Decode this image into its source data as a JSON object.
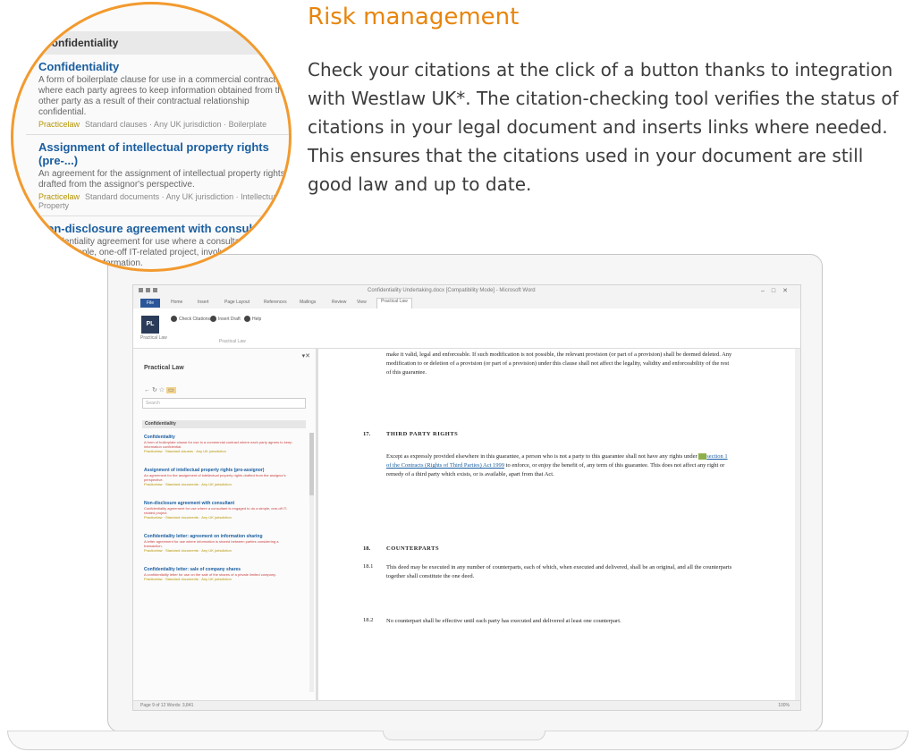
{
  "heading": "Risk management",
  "body": "Check your citations at the click of a button thanks to integration with Westlaw UK*. The citation-checking tool verifies the status of citations in your legal document and inserts links where needed. This ensures that the citations used in your document are still good law and up to date.",
  "accent_color": "#e8850c",
  "magnifier": {
    "header": "Confidentiality",
    "items": [
      {
        "title": "Confidentiality",
        "desc": "A form of boilerplate clause for use in a commercial contract where each party agrees to keep information obtained from the other party as a result of their contractual relationship confidential.",
        "tag": "Practicelaw",
        "meta": "Standard clauses · Any UK jurisdiction · Boilerplate"
      },
      {
        "title": "Assignment of intellectual property rights (pre-...)",
        "desc": "An agreement for the assignment of intellectual property rights drafted from the assignor's perspective.",
        "tag": "Practicelaw",
        "meta": "Standard documents · Any UK jurisdiction · Intellectual Property"
      },
      {
        "title": "Non-disclosure agreement with consultant",
        "desc": "Confidentiality agreement for use where a consultant is engaged to do a simple, one-off IT-related project, involving the disclosure of confidential information.",
        "tag": "",
        "meta": ""
      }
    ]
  },
  "screen": {
    "window_title": "Confidentiality Undertaking.docx [Compatibility Mode] - Microsoft Word",
    "ribbon_tabs": [
      "File",
      "Home",
      "Insert",
      "Page Layout",
      "References",
      "Mailings",
      "Review",
      "View",
      "Practical Law"
    ],
    "ribbon_buttons": [
      "Check Citations",
      "Insert Draft",
      "Help"
    ],
    "ribbon_big": "PL",
    "ribbon_big_label": "Practical Law",
    "ribbon_group": "Practical Law",
    "pane_title": "Practical Law",
    "pane_search": "Search",
    "pane_section": "Confidentiality",
    "pane_results": [
      {
        "title": "Confidentiality",
        "desc": "A form of boilerplate clause for use in a commercial contract where each party agrees to keep information confidential.",
        "meta": "Practicelaw · Standard clauses · Any UK jurisdiction"
      },
      {
        "title": "Assignment of intellectual property rights (pro-assignor)",
        "desc": "An agreement for the assignment of intellectual property rights drafted from the assignor's perspective.",
        "meta": "Practicelaw · Standard documents · Any UK jurisdiction"
      },
      {
        "title": "Non-disclosure agreement with consultant",
        "desc": "Confidentiality agreement for use where a consultant is engaged to do a simple, one-off IT-related project.",
        "meta": "Practicelaw · Standard documents · Any UK jurisdiction"
      },
      {
        "title": "Confidentiality letter: agreement on information sharing",
        "desc": "A letter agreement for use where information is shared between parties considering a transaction.",
        "meta": "Practicelaw · Standard documents · Any UK jurisdiction"
      },
      {
        "title": "Confidentiality letter: sale of company shares",
        "desc": "A confidentiality letter for use on the sale of the shares of a private limited company.",
        "meta": "Practicelaw · Standard documents · Any UK jurisdiction"
      }
    ],
    "doc": {
      "para1": "make it valid, legal and enforceable. If such modification is not possible, the relevant provision (or part of a provision) shall be deemed deleted. Any modification to or deletion of a provision (or part of a provision) under this clause shall not affect the legality, validity and enforceability of the rest of this guarantee.",
      "c17_num": "17.",
      "c17_title": "THIRD PARTY RIGHTS",
      "c17_text_a": "Except as expressly provided elsewhere in this guarantee, a person who is not a party to this guarantee shall not have any rights under",
      "c17_link": "section 1 of the Contracts (Rights of Third Parties) Act 1999",
      "c17_text_b": "to enforce, or enjoy the benefit of, any term of this guarantee. This does not affect any right or remedy of a third party which exists, or is available, apart from that Act.",
      "c18_num": "18.",
      "c18_title": "COUNTERPARTS",
      "c181_num": "18.1",
      "c181_text": "This deed may be executed in any number of counterparts, each of which, when executed and delivered, shall be an original, and all the counterparts together shall constitute the one deed.",
      "c182_num": "18.2",
      "c182_text": "No counterpart shall be effective until each party has executed and delivered at least one counterpart."
    },
    "status_left": "Page 9 of 12   Words: 3,841",
    "status_right": "100%"
  }
}
